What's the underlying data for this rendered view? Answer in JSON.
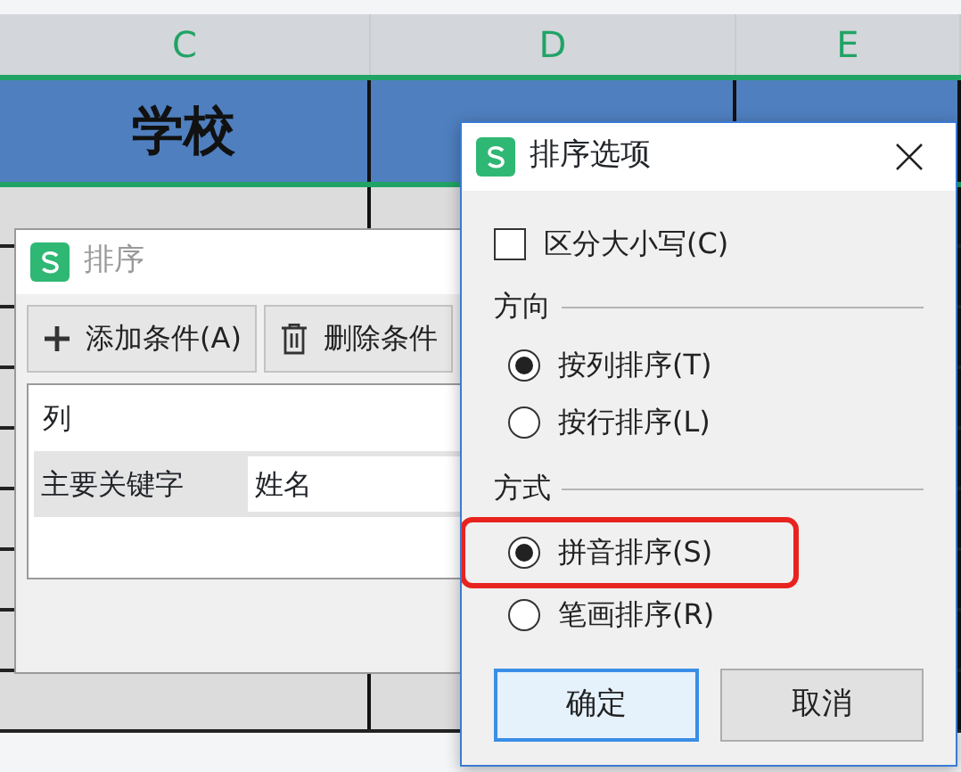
{
  "sheet": {
    "columns": [
      "C",
      "D",
      "E"
    ],
    "header_row": [
      "学校"
    ]
  },
  "sort_dialog": {
    "title": "排序",
    "active": false,
    "buttons": [
      {
        "label": "添加条件(A)",
        "kind": "add"
      },
      {
        "label": "删除条件",
        "kind": "delete"
      }
    ],
    "table": {
      "header": "列",
      "rows": [
        {
          "label": "主要关键字",
          "value": "姓名"
        }
      ]
    }
  },
  "options_dialog": {
    "title": "排序选项",
    "case_option": {
      "label": "区分大小写(C)",
      "checked": false
    },
    "groups": [
      {
        "title": "方向",
        "options": [
          {
            "label": "按列排序(T)",
            "selected": true,
            "highlighted": false
          },
          {
            "label": "按行排序(L)",
            "selected": false,
            "highlighted": false
          }
        ]
      },
      {
        "title": "方式",
        "options": [
          {
            "label": "拼音排序(S)",
            "selected": true,
            "highlighted": true
          },
          {
            "label": "笔画排序(R)",
            "selected": false,
            "highlighted": false
          }
        ]
      }
    ],
    "buttons": [
      {
        "label": "确定",
        "focused": true
      },
      {
        "label": "取消",
        "focused": false
      }
    ]
  }
}
